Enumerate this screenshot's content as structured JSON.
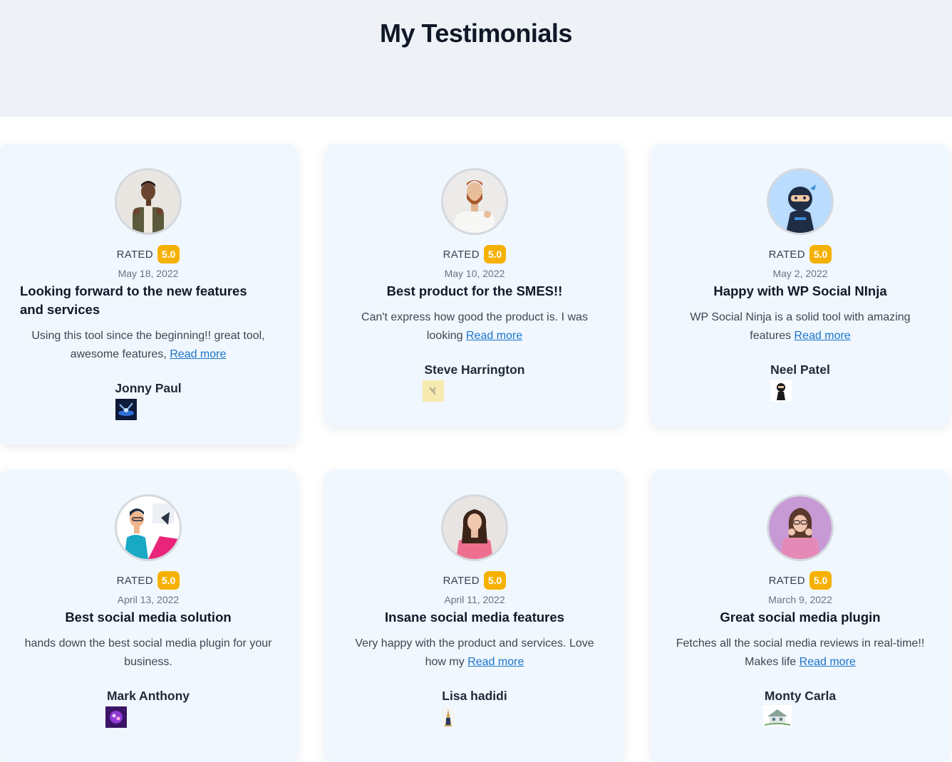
{
  "page": {
    "title": "My Testimonials"
  },
  "rated_label": "RATED",
  "read_more": "Read more",
  "testimonials": [
    {
      "rating": "5.0",
      "date": "May 18, 2022",
      "title": "Looking forward to the new features and services",
      "text": "Using this tool since the beginning!! great tool, awesome features,",
      "has_read_more": true,
      "author": "Jonny Paul",
      "avatar_icon": "man-avatar-icon",
      "platform_icon": "platform-logo-icon"
    },
    {
      "rating": "5.0",
      "date": "May 10, 2022",
      "title": "Best product for the SMES!!",
      "text": "Can't express how good the product is. I was looking",
      "has_read_more": true,
      "author": "Steve Harrington",
      "avatar_icon": "bearded-man-avatar-icon",
      "platform_icon": "platform-logo-icon"
    },
    {
      "rating": "5.0",
      "date": "May 2, 2022",
      "title": "Happy with WP Social NInja",
      "text": "WP Social Ninja is a solid tool with amazing features",
      "has_read_more": true,
      "author": "Neel Patel",
      "avatar_icon": "ninja-avatar-icon",
      "platform_icon": "ninja-logo-icon"
    },
    {
      "rating": "5.0",
      "date": "April 13, 2022",
      "title": "Best social media solution",
      "text": "hands down the best social media plugin for your business.",
      "has_read_more": false,
      "author": "Mark Anthony",
      "avatar_icon": "illustrated-man-avatar-icon",
      "platform_icon": "platform-logo-icon"
    },
    {
      "rating": "5.0",
      "date": "April 11, 2022",
      "title": "Insane social media features",
      "text": "Very happy with the product and services. Love how my",
      "has_read_more": true,
      "author": "Lisa hadidi",
      "avatar_icon": "woman-avatar-icon",
      "platform_icon": "platform-logo-icon"
    },
    {
      "rating": "5.0",
      "date": "March 9, 2022",
      "title": "Great social media plugin",
      "text": "Fetches all the social media reviews in real-time!! Makes life",
      "has_read_more": true,
      "author": "Monty Carla",
      "avatar_icon": "surprised-woman-avatar-icon",
      "platform_icon": "house-logo-icon"
    }
  ],
  "colors": {
    "hero_background": "#eef2f6",
    "card_background": "#f0f7ff",
    "rating_badge": "#f6b100",
    "link": "#1a73c9"
  }
}
